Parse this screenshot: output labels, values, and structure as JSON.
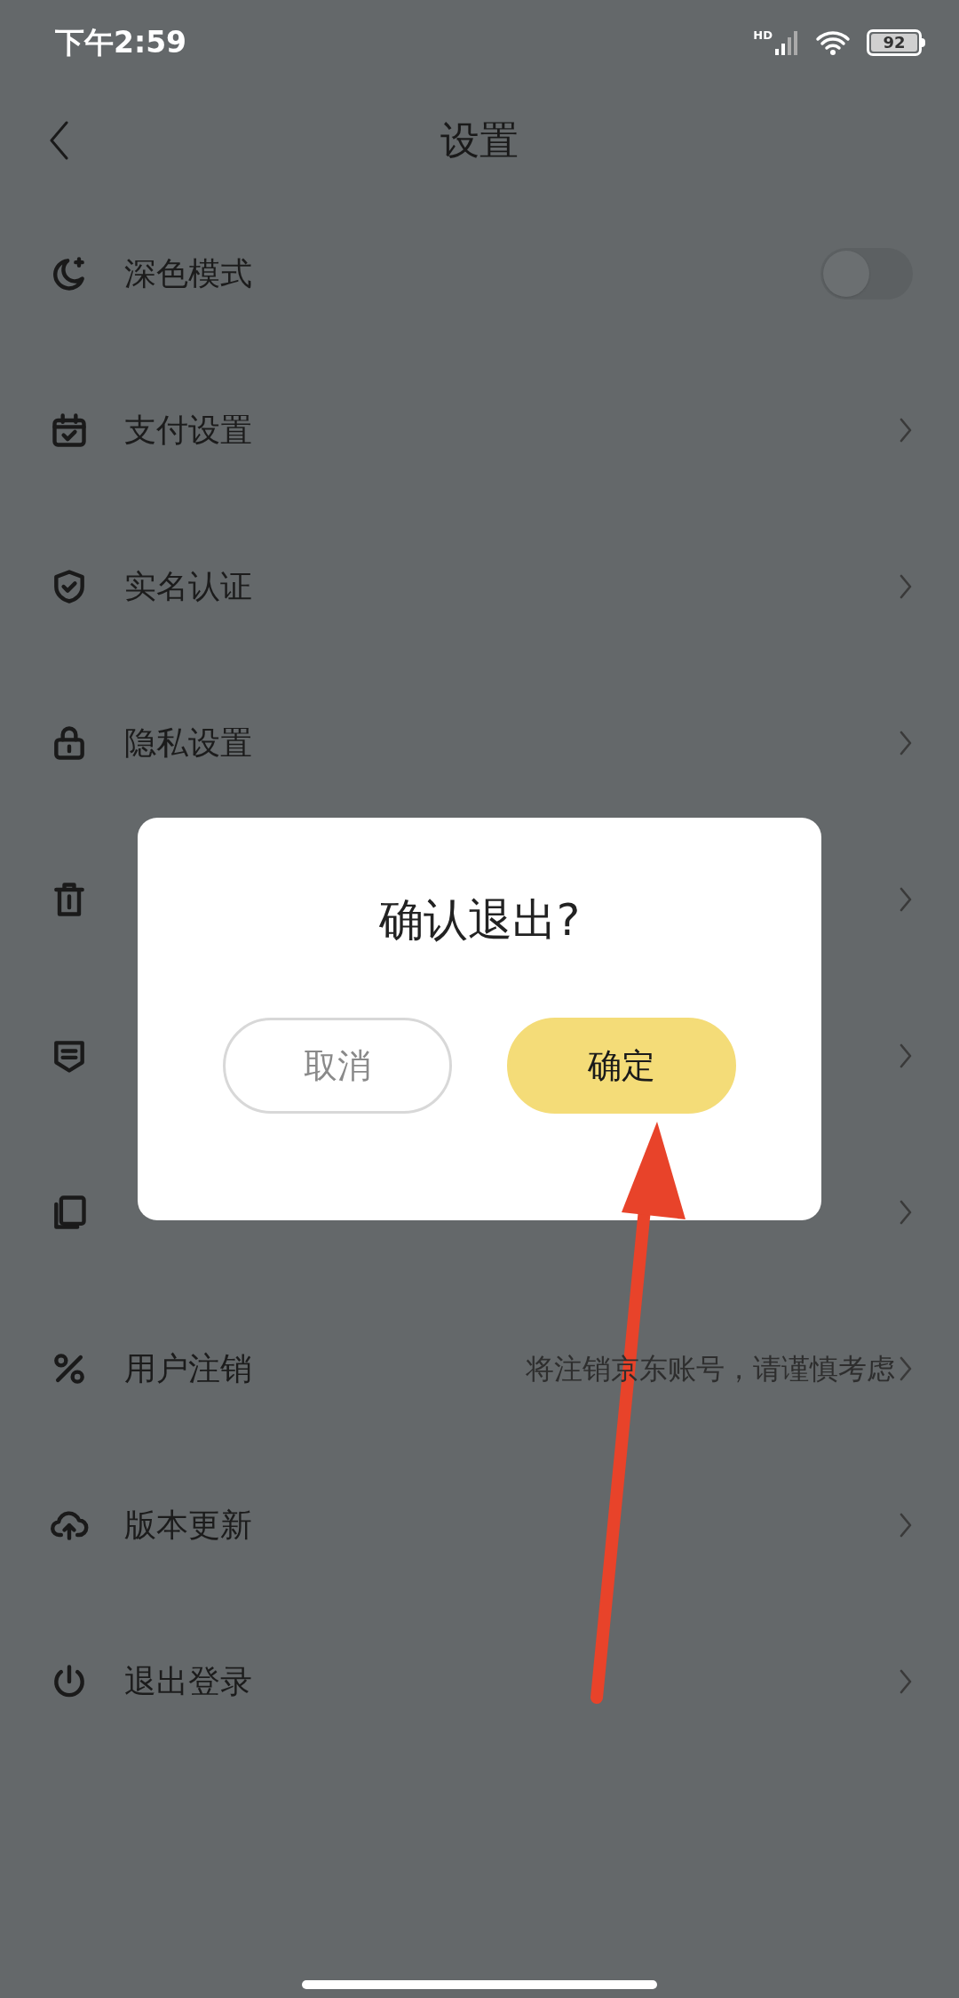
{
  "status_bar": {
    "time": "下午2:59",
    "network": "HD",
    "battery": "92"
  },
  "nav": {
    "title": "设置"
  },
  "rows": [
    {
      "kind": "toggle",
      "label": "深色模式",
      "on": false
    },
    {
      "kind": "link",
      "label": "支付设置"
    },
    {
      "kind": "link",
      "label": "实名认证"
    },
    {
      "kind": "link",
      "label": "隐私设置"
    },
    {
      "kind": "link"
    },
    {
      "kind": "link"
    },
    {
      "kind": "link"
    },
    {
      "kind": "link",
      "label": "用户注销",
      "hint": "将注销京东账号，请谨慎考虑"
    },
    {
      "kind": "link",
      "label": "版本更新"
    },
    {
      "kind": "link",
      "label": "退出登录"
    }
  ],
  "dialog": {
    "title": "确认退出?",
    "buttons": [
      {
        "label": "取消",
        "kind": "secondary"
      },
      {
        "label": "确定",
        "kind": "primary"
      }
    ]
  }
}
